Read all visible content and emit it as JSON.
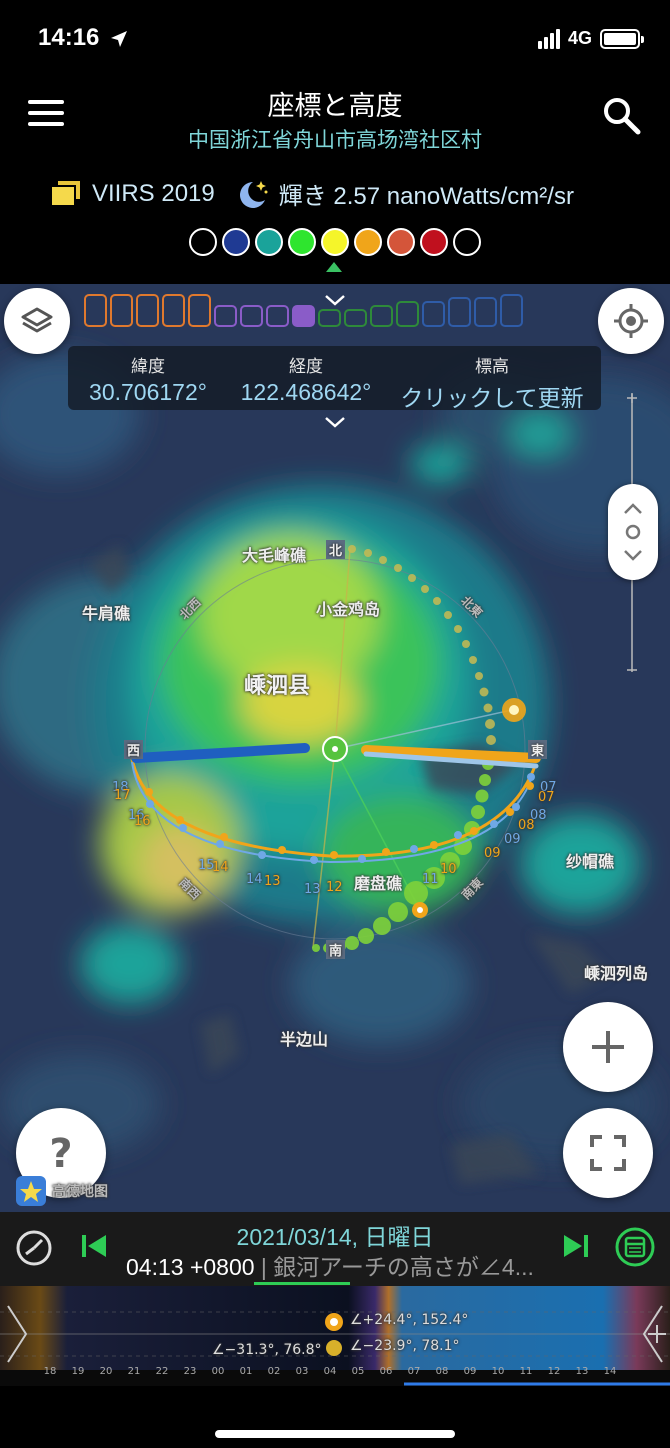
{
  "status": {
    "time": "14:16",
    "network": "4G"
  },
  "header": {
    "title": "座標と高度",
    "subtitle": "中国浙江省舟山市高场湾社区村",
    "layer_name": "VIIRS 2019",
    "brightness": "輝き 2.57 nanoWatts/cm²/sr"
  },
  "swatches": [
    "#000000",
    "#1f3a93",
    "#1aa39a",
    "#2ee52e",
    "#f5f52a",
    "#f0a51a",
    "#d4553a",
    "#c0101e",
    "#000000"
  ],
  "coords": {
    "lat_label": "緯度",
    "lat_value": "30.706172°",
    "lon_label": "経度",
    "lon_value": "122.468642°",
    "elev_label": "標高",
    "elev_value": "クリックして更新"
  },
  "map_labels": {
    "a": "大毛峰礁",
    "b": "小金鸡岛",
    "c": "牛肩礁",
    "d": "嵊泗县",
    "e": "磨盘礁",
    "f": "纱帽礁",
    "g": "嵊泗列岛",
    "h": "半边山",
    "i": "高德地图"
  },
  "compass": {
    "n": "北",
    "e": "東",
    "w": "西",
    "s": "南",
    "ne": "北東",
    "nw": "北西",
    "se": "南東",
    "sw": "南西"
  },
  "hours_blue": [
    "18",
    "17",
    "16",
    "15",
    "14",
    "13",
    "12",
    "11",
    "10",
    "09",
    "08",
    "07"
  ],
  "hours_orange": [
    "17",
    "16",
    "15",
    "14",
    "13",
    "12",
    "11",
    "10",
    "09",
    "08",
    "07"
  ],
  "timebar": {
    "date": "2021/03/14, 日曜日",
    "time": "04:13 +0800",
    "desc": " | 銀河アーチの高さが∠4..."
  },
  "timeline": {
    "milky": "∠+24.4°, 152.4°",
    "moon": "∠−31.3°, 76.8°",
    "sun": "∠−23.9°, 78.1°",
    "hours": [
      "18",
      "19",
      "20",
      "21",
      "22",
      "23",
      "00",
      "01",
      "02",
      "03",
      "04",
      "05",
      "06",
      "07",
      "08",
      "09",
      "10",
      "11",
      "12",
      "13",
      "14"
    ]
  },
  "colors": {
    "accent_green": "#2ecc55",
    "teal": "#7fd6d9",
    "orange": "#f0a51a",
    "blue": "#2f7be8"
  }
}
